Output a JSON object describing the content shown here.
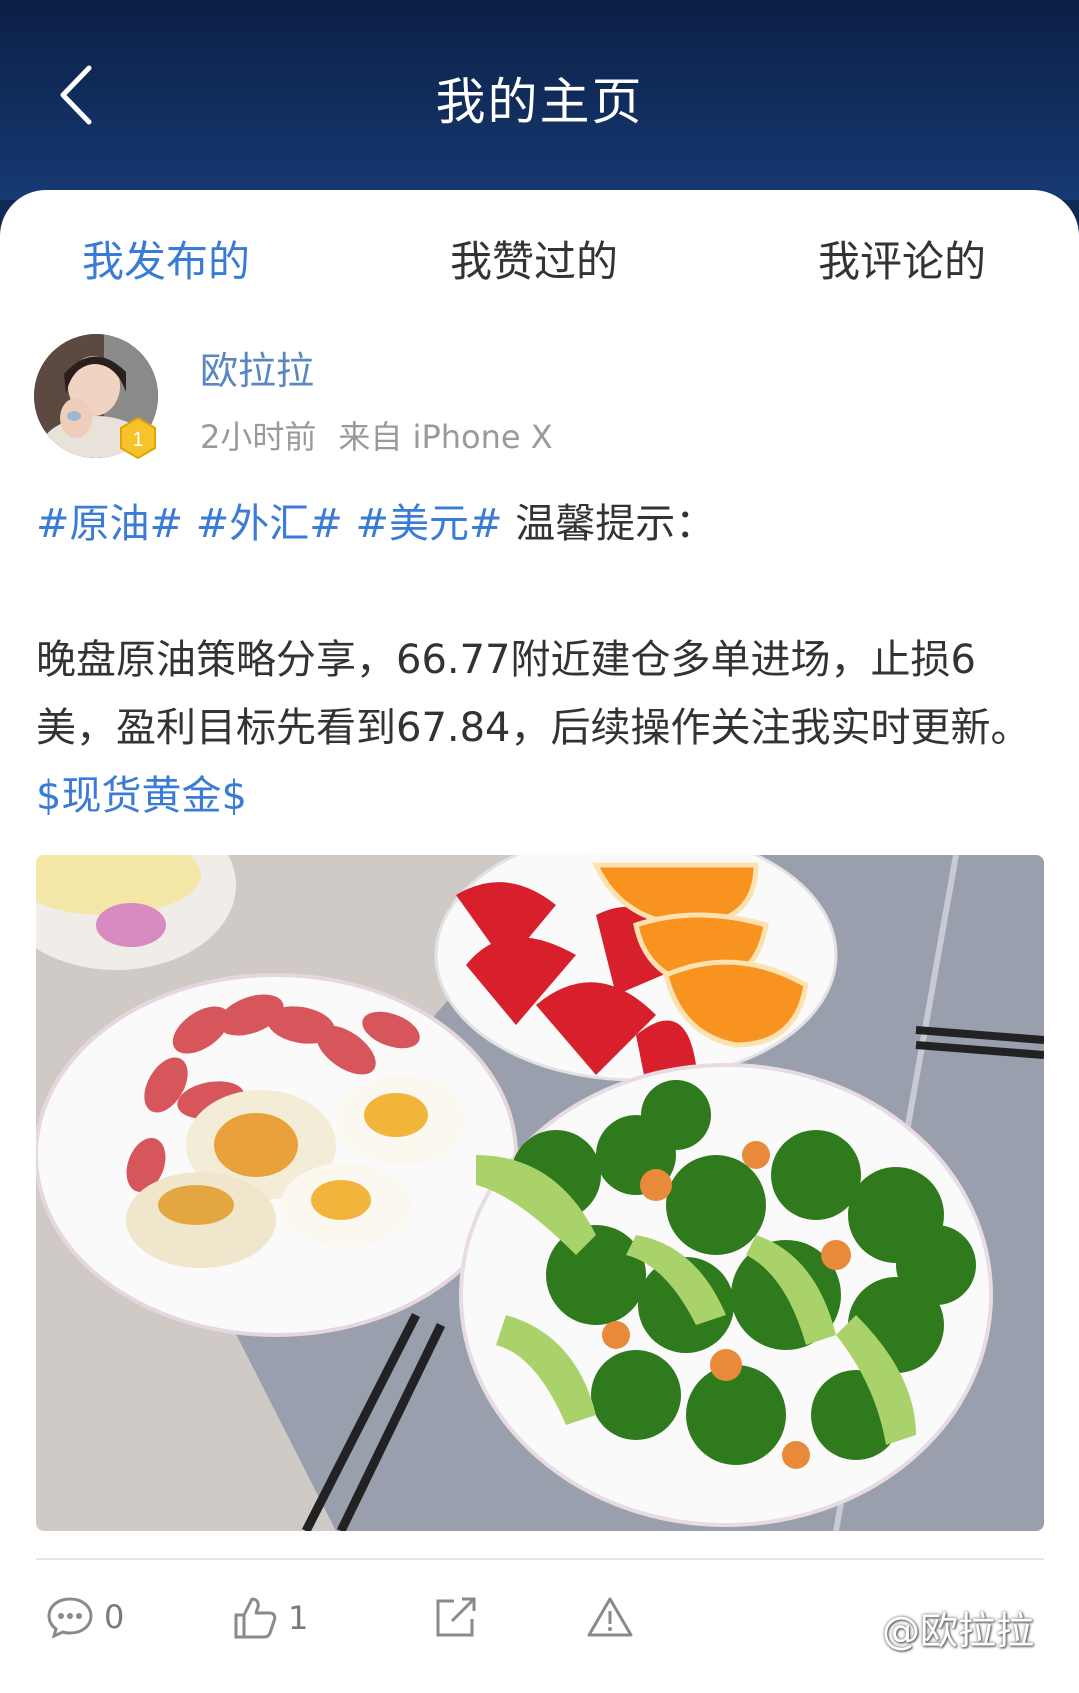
{
  "header": {
    "title": "我的主页"
  },
  "tabs": [
    {
      "label": "我发布的",
      "active": true
    },
    {
      "label": "我赞过的",
      "active": false
    },
    {
      "label": "我评论的",
      "active": false
    }
  ],
  "post": {
    "user": {
      "name": "欧拉拉",
      "level": "1"
    },
    "time": "2小时前",
    "source": "来自 iPhone X",
    "tags": [
      "#原油#",
      "#外汇#",
      "#美元#"
    ],
    "intro": "温馨提示：",
    "body": "晚盘原油策略分享，66.77附近建仓多单进场，止损6美，盈利目标先看到67.84，后续操作关注我实时更新。",
    "stock_tag": "$现货黄金$"
  },
  "actions": {
    "comments": "0",
    "likes": "1"
  },
  "watermark": "@欧拉拉",
  "colors": {
    "header_bg": "#0f2a55",
    "accent": "#3a7bd5",
    "username": "#5a86c2"
  }
}
